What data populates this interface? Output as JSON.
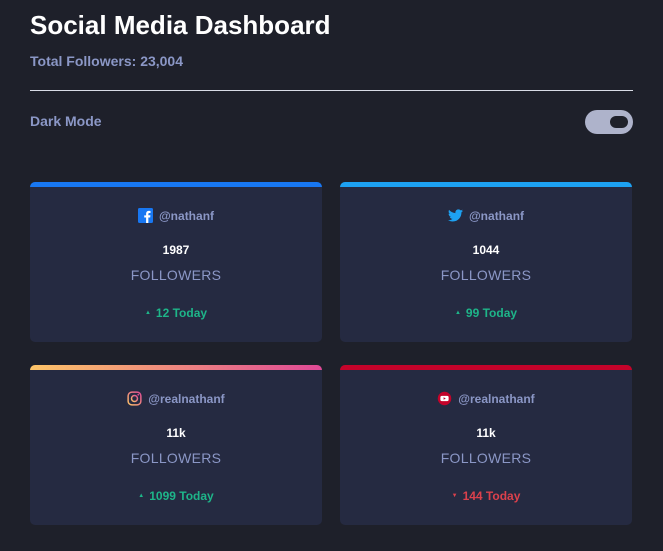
{
  "header": {
    "title": "Social Media Dashboard",
    "total_followers": "Total Followers: 23,004"
  },
  "mode": {
    "label": "Dark Mode",
    "enabled": true
  },
  "colors": {
    "background": "#1e202a",
    "card": "#252a41",
    "facebook": "#1877f2",
    "twitter": "#1da1f2",
    "instagram_gradient": [
      "#fdc468",
      "#df4996"
    ],
    "youtube": "#c4032a",
    "up": "#1eb589",
    "down": "#dc414c"
  },
  "cards": [
    {
      "network": "facebook",
      "icon": "facebook-icon",
      "handle": "@nathanf",
      "count": "1987",
      "unit": "FOLLOWERS",
      "arrow": "▲",
      "delta": "12 Today",
      "trend": "up"
    },
    {
      "network": "twitter",
      "icon": "twitter-icon",
      "handle": "@nathanf",
      "count": "1044",
      "unit": "FOLLOWERS",
      "arrow": "▲",
      "delta": "99 Today",
      "trend": "up"
    },
    {
      "network": "instagram",
      "icon": "instagram-icon",
      "handle": "@realnathanf",
      "count": "11k",
      "unit": "FOLLOWERS",
      "arrow": "▲",
      "delta": "1099 Today",
      "trend": "up"
    },
    {
      "network": "youtube",
      "icon": "youtube-icon",
      "handle": "@realnathanf",
      "count": "11k",
      "unit": "FOLLOWERS",
      "arrow": "▼",
      "delta": "144 Today",
      "trend": "down"
    }
  ]
}
